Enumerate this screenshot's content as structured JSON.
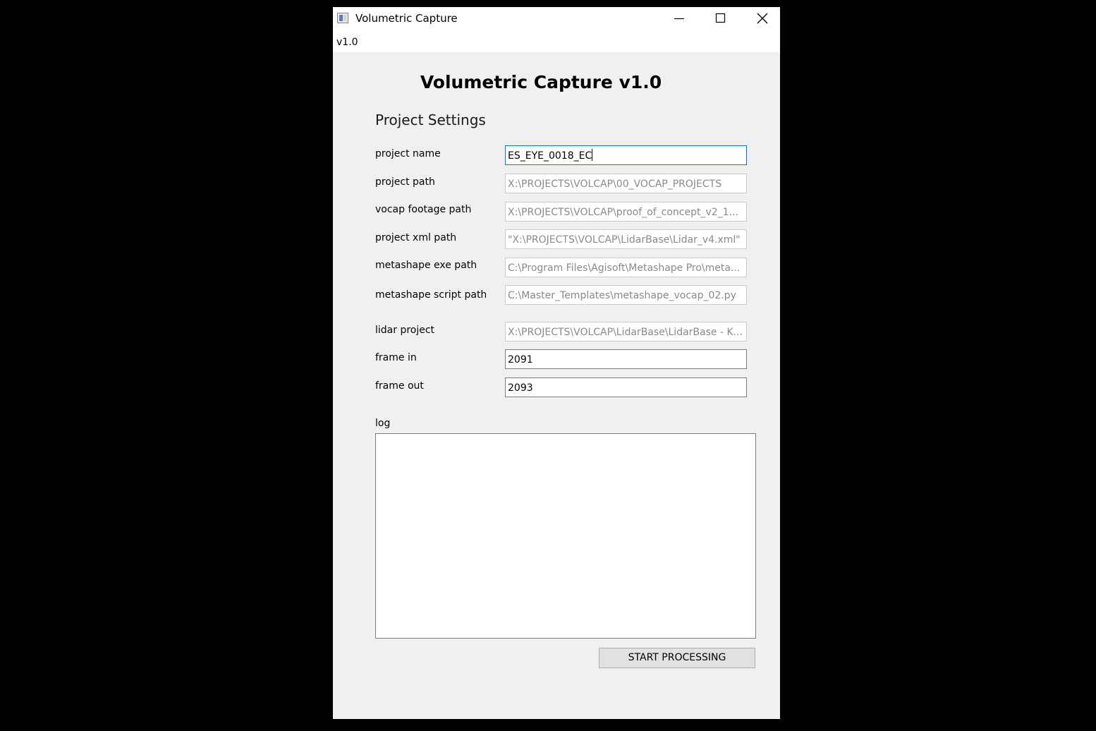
{
  "window": {
    "title": "Volumetric Capture",
    "controls": {
      "minimize": "minimize-icon",
      "maximize": "maximize-icon",
      "close": "close-icon"
    }
  },
  "menu": {
    "items": [
      "v1.0"
    ]
  },
  "heading": "Volumetric Capture v1.0",
  "section_title": "Project Settings",
  "fields": [
    {
      "label": "project name",
      "value": "ES_EYE_0018_EC",
      "enabled": true,
      "focused": true
    },
    {
      "label": "project path",
      "value": "X:\\PROJECTS\\VOLCAP\\00_VOCAP_PROJECTS",
      "enabled": false
    },
    {
      "label": "vocap footage path",
      "value": "X:\\PROJECTS\\VOLCAP\\proof_of_concept_v2_1...",
      "enabled": false
    },
    {
      "label": "project xml path",
      "value": "\"X:\\PROJECTS\\VOLCAP\\LidarBase\\Lidar_v4.xml\"",
      "enabled": false
    },
    {
      "label": "metashape exe path",
      "value": "C:\\Program Files\\Agisoft\\Metashape Pro\\meta...",
      "enabled": false
    },
    {
      "label": "metashape script path",
      "value": "C:\\Master_Templates\\metashape_vocap_02.py",
      "enabled": false
    },
    {
      "label": "lidar project",
      "value": "X:\\PROJECTS\\VOLCAP\\LidarBase\\LidarBase - K...",
      "enabled": false
    },
    {
      "label": "frame in",
      "value": "2091",
      "enabled": true
    },
    {
      "label": "frame out",
      "value": "2093",
      "enabled": true
    }
  ],
  "log": {
    "label": "log",
    "content": ""
  },
  "start_button": {
    "label": "START PROCESSING"
  },
  "colors": {
    "focus_border": "#0078d4",
    "window_bg": "#f0f0f0",
    "disabled_text": "#8a8a8a"
  }
}
